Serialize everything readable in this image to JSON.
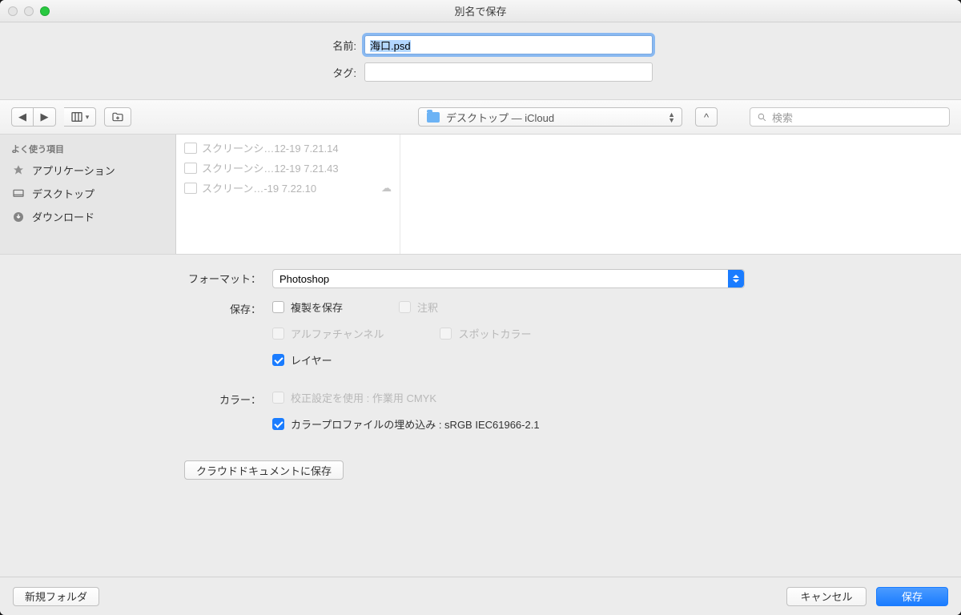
{
  "title": "別名で保存",
  "name_label": "名前:",
  "name_value": "海口.psd",
  "tag_label": "タグ:",
  "tag_value": "",
  "location": "デスクトップ — iCloud",
  "search_placeholder": "検索",
  "sidebar": {
    "header": "よく使う項目",
    "items": [
      "アプリケーション",
      "デスクトップ",
      "ダウンロード"
    ]
  },
  "files": [
    "スクリーンシ…12-19 7.21.14",
    "スクリーンシ…12-19 7.21.43",
    "スクリーン…-19 7.22.10"
  ],
  "format_label": "フォーマット：",
  "format_value": "Photoshop",
  "save_label": "保存：",
  "opt_save_copy": "複製を保存",
  "opt_notes": "注釈",
  "opt_alpha": "アルファチャンネル",
  "opt_spot": "スポットカラー",
  "opt_layers": "レイヤー",
  "color_label": "カラー：",
  "opt_proof": "校正設定を使用 : 作業用 CMYK",
  "opt_embed": "カラープロファイルの埋め込み : sRGB IEC61966-2.1",
  "cloud_save": "クラウドドキュメントに保存",
  "new_folder": "新規フォルダ",
  "cancel": "キャンセル",
  "save": "保存"
}
